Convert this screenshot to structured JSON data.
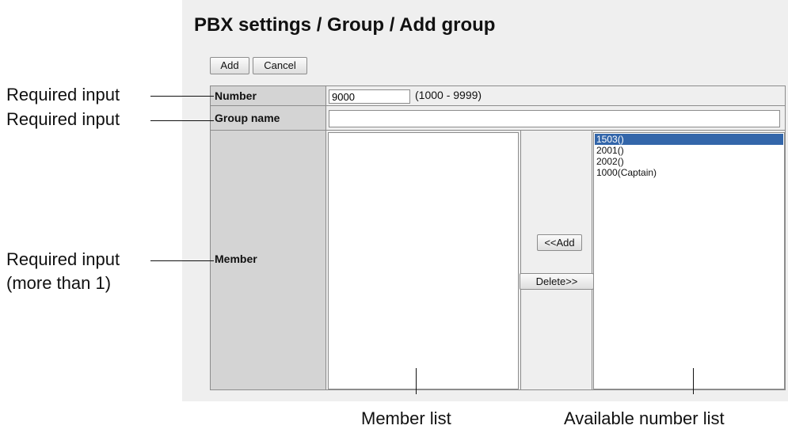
{
  "page": {
    "title": "PBX settings / Group / Add group"
  },
  "toolbar": {
    "add_label": "Add",
    "cancel_label": "Cancel"
  },
  "form": {
    "number": {
      "label": "Number",
      "value": "9000",
      "range": "(1000 - 9999)"
    },
    "group_name": {
      "label": "Group name",
      "value": ""
    },
    "member": {
      "label": "Member",
      "add_label": "<<Add",
      "delete_label": "Delete>>"
    }
  },
  "available_numbers": [
    {
      "label": "1503()",
      "selected": true
    },
    {
      "label": "2001()",
      "selected": false
    },
    {
      "label": "2002()",
      "selected": false
    },
    {
      "label": "1000(Captain)",
      "selected": false
    }
  ],
  "annotations": {
    "number_note": "Required input",
    "group_name_note": "Required input",
    "member_note_line1": "Required input",
    "member_note_line2": "(more than 1)",
    "member_list_caption": "Member list",
    "available_list_caption": "Available number list"
  },
  "colors": {
    "selection": "#3366aa",
    "panel_bg": "#efefef",
    "label_bg": "#d4d4d4"
  }
}
